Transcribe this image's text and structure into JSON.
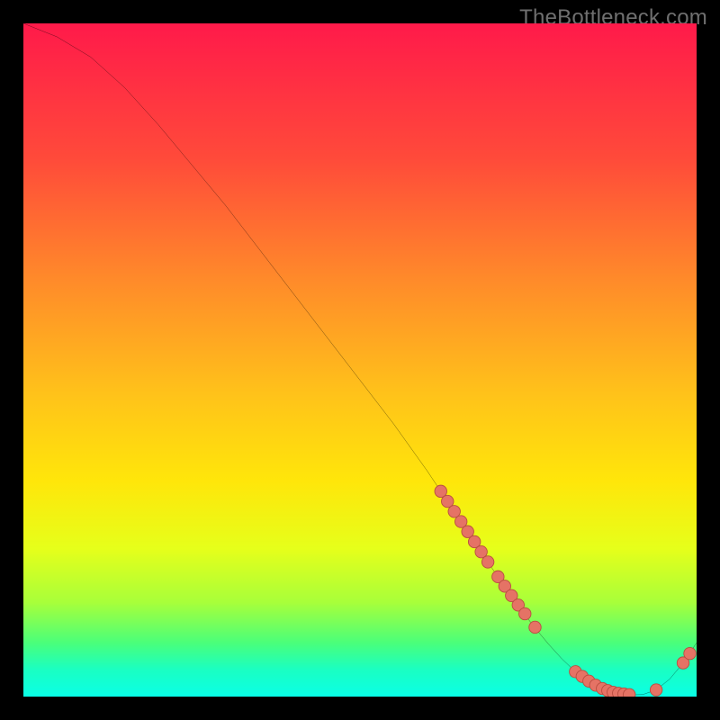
{
  "watermark": "TheBottleneck.com",
  "colors": {
    "background": "#000000",
    "watermark_text": "#6f6f6f",
    "curve_stroke": "#000000",
    "marker_fill": "#e57365",
    "marker_stroke": "#b94d40"
  },
  "chart_data": {
    "type": "line",
    "title": "",
    "xlabel": "",
    "ylabel": "",
    "xlim": [
      0,
      100
    ],
    "ylim": [
      0,
      100
    ],
    "grid": false,
    "series": [
      {
        "name": "bottleneck-curve",
        "x": [
          0,
          5,
          10,
          15,
          20,
          25,
          30,
          35,
          40,
          45,
          50,
          55,
          60,
          62,
          64,
          66,
          68,
          69,
          70,
          72,
          74,
          76,
          78,
          80,
          82,
          84,
          86,
          88,
          90,
          92,
          94,
          96,
          98,
          100
        ],
        "y": [
          100,
          98,
          95,
          90.5,
          85,
          79,
          73,
          66.5,
          60,
          53.5,
          47,
          40.5,
          33.5,
          30.5,
          27.5,
          24.5,
          21.5,
          20,
          18.5,
          15.6,
          12.8,
          10.2,
          7.8,
          5.6,
          3.7,
          2.2,
          1.1,
          0.45,
          0.25,
          0.3,
          1.0,
          2.6,
          5.0,
          8.0
        ]
      }
    ],
    "markers": [
      {
        "x": 62,
        "y": 30.5
      },
      {
        "x": 63,
        "y": 29.0
      },
      {
        "x": 64,
        "y": 27.5
      },
      {
        "x": 65,
        "y": 26.0
      },
      {
        "x": 66,
        "y": 24.5
      },
      {
        "x": 67,
        "y": 23.0
      },
      {
        "x": 68,
        "y": 21.5
      },
      {
        "x": 69,
        "y": 20.0
      },
      {
        "x": 70.5,
        "y": 17.8
      },
      {
        "x": 71.5,
        "y": 16.4
      },
      {
        "x": 72.5,
        "y": 15.0
      },
      {
        "x": 73.5,
        "y": 13.6
      },
      {
        "x": 74.5,
        "y": 12.3
      },
      {
        "x": 76,
        "y": 10.3
      },
      {
        "x": 82,
        "y": 3.7
      },
      {
        "x": 83,
        "y": 3.0
      },
      {
        "x": 84,
        "y": 2.3
      },
      {
        "x": 85,
        "y": 1.7
      },
      {
        "x": 86,
        "y": 1.2
      },
      {
        "x": 86.8,
        "y": 0.9
      },
      {
        "x": 87.6,
        "y": 0.65
      },
      {
        "x": 88.4,
        "y": 0.5
      },
      {
        "x": 89.2,
        "y": 0.4
      },
      {
        "x": 90,
        "y": 0.3
      },
      {
        "x": 94,
        "y": 1.0
      },
      {
        "x": 98,
        "y": 5.0
      },
      {
        "x": 99,
        "y": 6.4
      }
    ]
  }
}
